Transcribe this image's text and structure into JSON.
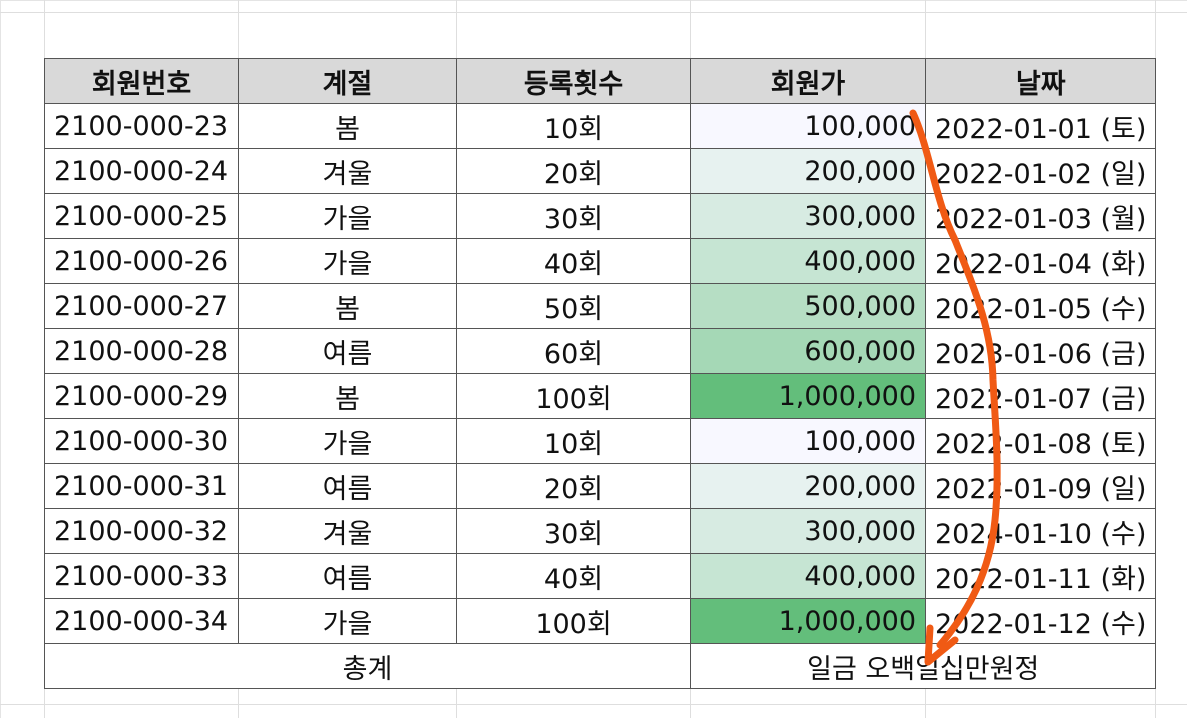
{
  "headers": [
    "회원번호",
    "계절",
    "등록횟수",
    "회원가",
    "날짜"
  ],
  "rows": [
    {
      "id": "2100-000-23",
      "season": "봄",
      "count": "10회",
      "price": "100,000",
      "price_value": 100000,
      "date": "2022-01-01 (토)"
    },
    {
      "id": "2100-000-24",
      "season": "겨울",
      "count": "20회",
      "price": "200,000",
      "price_value": 200000,
      "date": "2022-01-02 (일)"
    },
    {
      "id": "2100-000-25",
      "season": "가을",
      "count": "30회",
      "price": "300,000",
      "price_value": 300000,
      "date": "2022-01-03 (월)"
    },
    {
      "id": "2100-000-26",
      "season": "가을",
      "count": "40회",
      "price": "400,000",
      "price_value": 400000,
      "date": "2022-01-04 (화)"
    },
    {
      "id": "2100-000-27",
      "season": "봄",
      "count": "50회",
      "price": "500,000",
      "price_value": 500000,
      "date": "2022-01-05 (수)"
    },
    {
      "id": "2100-000-28",
      "season": "여름",
      "count": "60회",
      "price": "600,000",
      "price_value": 600000,
      "date": "2023-01-06 (금)"
    },
    {
      "id": "2100-000-29",
      "season": "봄",
      "count": "100회",
      "price": "1,000,000",
      "price_value": 1000000,
      "date": "2022-01-07 (금)"
    },
    {
      "id": "2100-000-30",
      "season": "가을",
      "count": "10회",
      "price": "100,000",
      "price_value": 100000,
      "date": "2022-01-08 (토)"
    },
    {
      "id": "2100-000-31",
      "season": "여름",
      "count": "20회",
      "price": "200,000",
      "price_value": 200000,
      "date": "2022-01-09 (일)"
    },
    {
      "id": "2100-000-32",
      "season": "겨울",
      "count": "30회",
      "price": "300,000",
      "price_value": 300000,
      "date": "2024-01-10 (수)"
    },
    {
      "id": "2100-000-33",
      "season": "여름",
      "count": "40회",
      "price": "400,000",
      "price_value": 400000,
      "date": "2022-01-11 (화)"
    },
    {
      "id": "2100-000-34",
      "season": "가을",
      "count": "100회",
      "price": "1,000,000",
      "price_value": 1000000,
      "date": "2022-01-12 (수)"
    }
  ],
  "total": {
    "label": "총계",
    "value_text": "일금 오백일십만원정"
  },
  "colors": {
    "header_bg": "#d9d9d9",
    "scale_low": "#f8f8ff",
    "scale_high": "#63be7b",
    "annotation_arrow": "#f05a14"
  }
}
